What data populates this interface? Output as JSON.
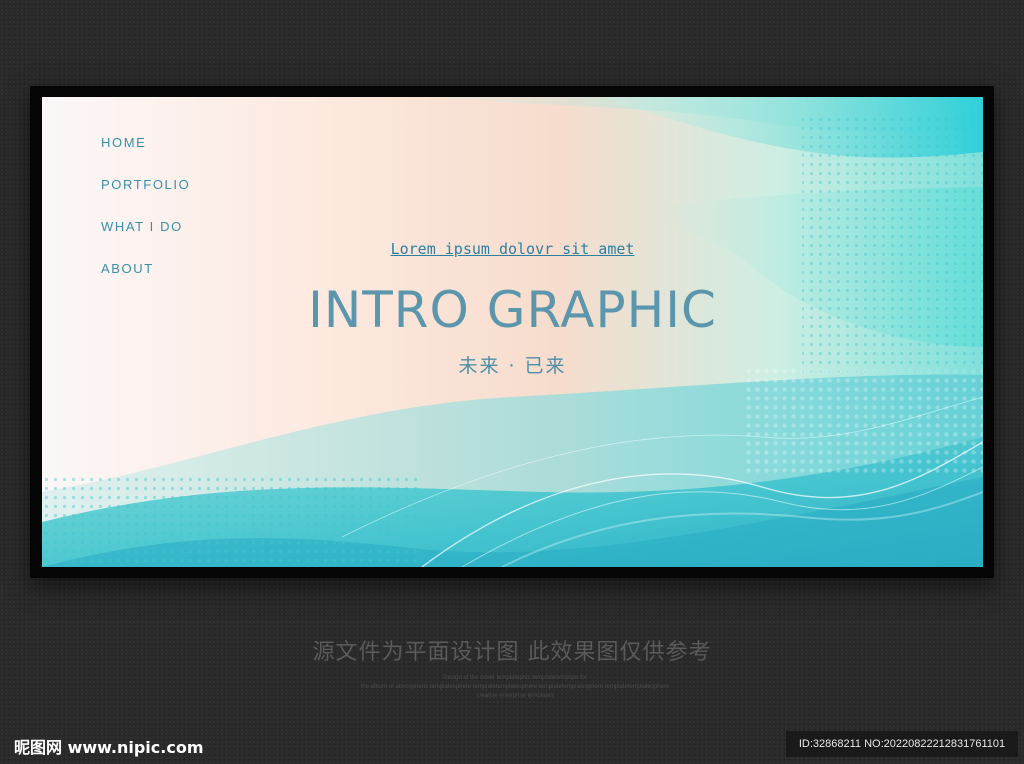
{
  "nav": {
    "items": [
      {
        "label": "HOME"
      },
      {
        "label": "PORTFOLIO"
      },
      {
        "label": "WHAT I DO"
      },
      {
        "label": "ABOUT"
      }
    ]
  },
  "hero": {
    "tagline": "Lorem ipsum dolovr sit amet",
    "title": "INTRO GRAPHIC",
    "subtitle": "未来 · 已来"
  },
  "caption": "源文件为平面设计图 此效果图仅供参考",
  "fine_print": [
    "Design of the cover templatephic templatetemplate for",
    "the album of atmospheric templatesphere templatetemplatesphere templatetemplatesphere templatetemplatesphere",
    "creative enterprise templates"
  ],
  "watermark": {
    "site": "昵图网 www.nipic.com",
    "id": "ID:32868211 NO:20220822212831761101"
  },
  "colors": {
    "accent": "#3a8fa6",
    "title": "#5b96ad",
    "teal": "#2fc7cf"
  }
}
